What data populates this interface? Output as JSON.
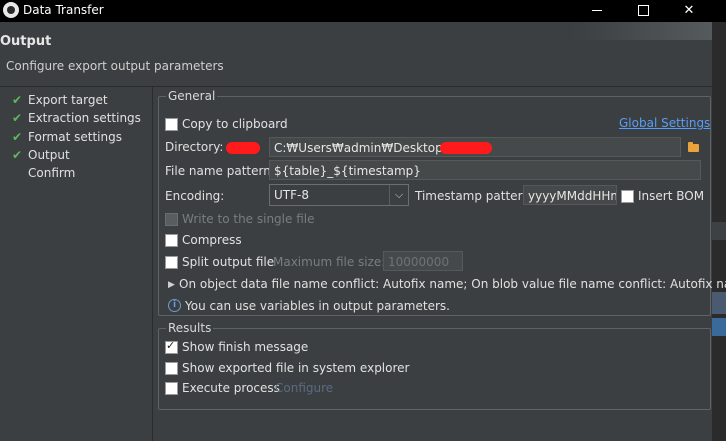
{
  "window": {
    "title": "Data Transfer",
    "min_label": "",
    "max_label": "",
    "close_label": "✕"
  },
  "header": {
    "title": "Output",
    "subtitle": "Configure export output parameters"
  },
  "steps": [
    {
      "label": "Export target",
      "done": true
    },
    {
      "label": "Extraction settings",
      "done": true
    },
    {
      "label": "Format settings",
      "done": true
    },
    {
      "label": "Output",
      "done": true
    },
    {
      "label": "Confirm",
      "done": false
    }
  ],
  "general": {
    "legend": "General",
    "copy_to_clipboard": "Copy to clipboard",
    "global_settings": "Global Settings",
    "directory_label": "Directory:",
    "directory_value": "C:₩Users₩admin₩Desktop",
    "file_name_pattern_label": "File name pattern:",
    "file_name_pattern_value": "${table}_${timestamp}",
    "encoding_label": "Encoding:",
    "encoding_value": "UTF-8",
    "timestamp_pattern_label": "Timestamp pattern:",
    "timestamp_pattern_value": "yyyyMMddHHm",
    "insert_bom": "Insert BOM",
    "write_single_file": "Write to the single file",
    "compress": "Compress",
    "split_output_file": "Split output file",
    "max_file_size_label": "Maximum file size:",
    "max_file_size_value": "10000000",
    "conflict_text": "On object data file name conflict: Autofix name; On blob value file name conflict: Autofix name",
    "info_text": "You can use variables in output parameters."
  },
  "results": {
    "legend": "Results",
    "show_finish_message": "Show finish message",
    "show_exported_file": "Show exported file in system explorer",
    "execute_process": "Execute process",
    "configure": "Configure"
  },
  "colors": {
    "accent_link": "#589df6",
    "check_green": "#5fb85f",
    "redaction": "#ff1b1b"
  },
  "icons": [
    "app-icon",
    "minimize-icon",
    "maximize-icon",
    "close-icon",
    "folder-icon",
    "expand-triangle-icon",
    "info-icon",
    "check-icon"
  ]
}
